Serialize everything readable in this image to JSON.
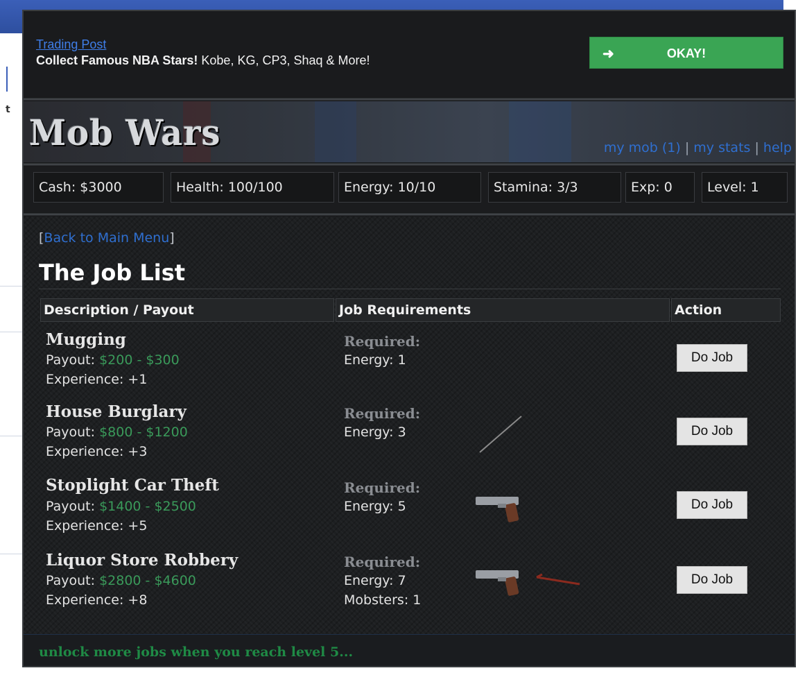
{
  "colors": {
    "okay_green": "#3aa554",
    "payout_green": "#3a9a5a",
    "link_blue": "#2f6fd0",
    "unlock_green": "#1f8a45"
  },
  "background_page": {
    "mark": "t"
  },
  "promo": {
    "link": "Trading Post",
    "headline": "Collect Famous NBA Stars!",
    "detail": "Kobe, KG, CP3, Shaq & More!",
    "button_icon": "arrow-right-icon",
    "button_label": "OKAY!"
  },
  "header": {
    "logo": "Mob Wars",
    "links": [
      "my mob (1)",
      "my stats",
      "help"
    ],
    "separator": "|"
  },
  "stats": [
    "Cash: $3000",
    "Health: 100/100",
    "Energy: 10/10",
    "Stamina: 3/3",
    "Exp: 0",
    "Level: 1"
  ],
  "nav": {
    "open": "[",
    "back": "Back to Main Menu",
    "close": "]"
  },
  "title": "The Job List",
  "table": {
    "headers": [
      "Description / Payout",
      "Job Requirements",
      "Action"
    ],
    "jobs": [
      {
        "name": "Mugging",
        "payout_label": "Payout:",
        "payout": "$200 - $300",
        "experience": "Experience: +1",
        "required_label": "Required:",
        "requirements": [
          "Energy: 1"
        ],
        "items": [],
        "action": "Do Job"
      },
      {
        "name": "House Burglary",
        "payout_label": "Payout:",
        "payout": "$800 - $1200",
        "experience": "Experience: +3",
        "required_label": "Required:",
        "requirements": [
          "Energy: 3"
        ],
        "items": [
          "crowbar-icon"
        ],
        "action": "Do Job"
      },
      {
        "name": "Stoplight Car Theft",
        "payout_label": "Payout:",
        "payout": "$1400 - $2500",
        "experience": "Experience: +5",
        "required_label": "Required:",
        "requirements": [
          "Energy: 5"
        ],
        "items": [
          "pistol-icon"
        ],
        "action": "Do Job"
      },
      {
        "name": "Liquor Store Robbery",
        "payout_label": "Payout:",
        "payout": "$2800 - $4600",
        "experience": "Experience: +8",
        "required_label": "Required:",
        "requirements": [
          "Energy: 7",
          "Mobsters: 1"
        ],
        "items": [
          "pistol-icon",
          "crowbar-icon"
        ],
        "action": "Do Job"
      }
    ]
  },
  "footer": {
    "unlock": "unlock more jobs when you reach level 5..."
  }
}
